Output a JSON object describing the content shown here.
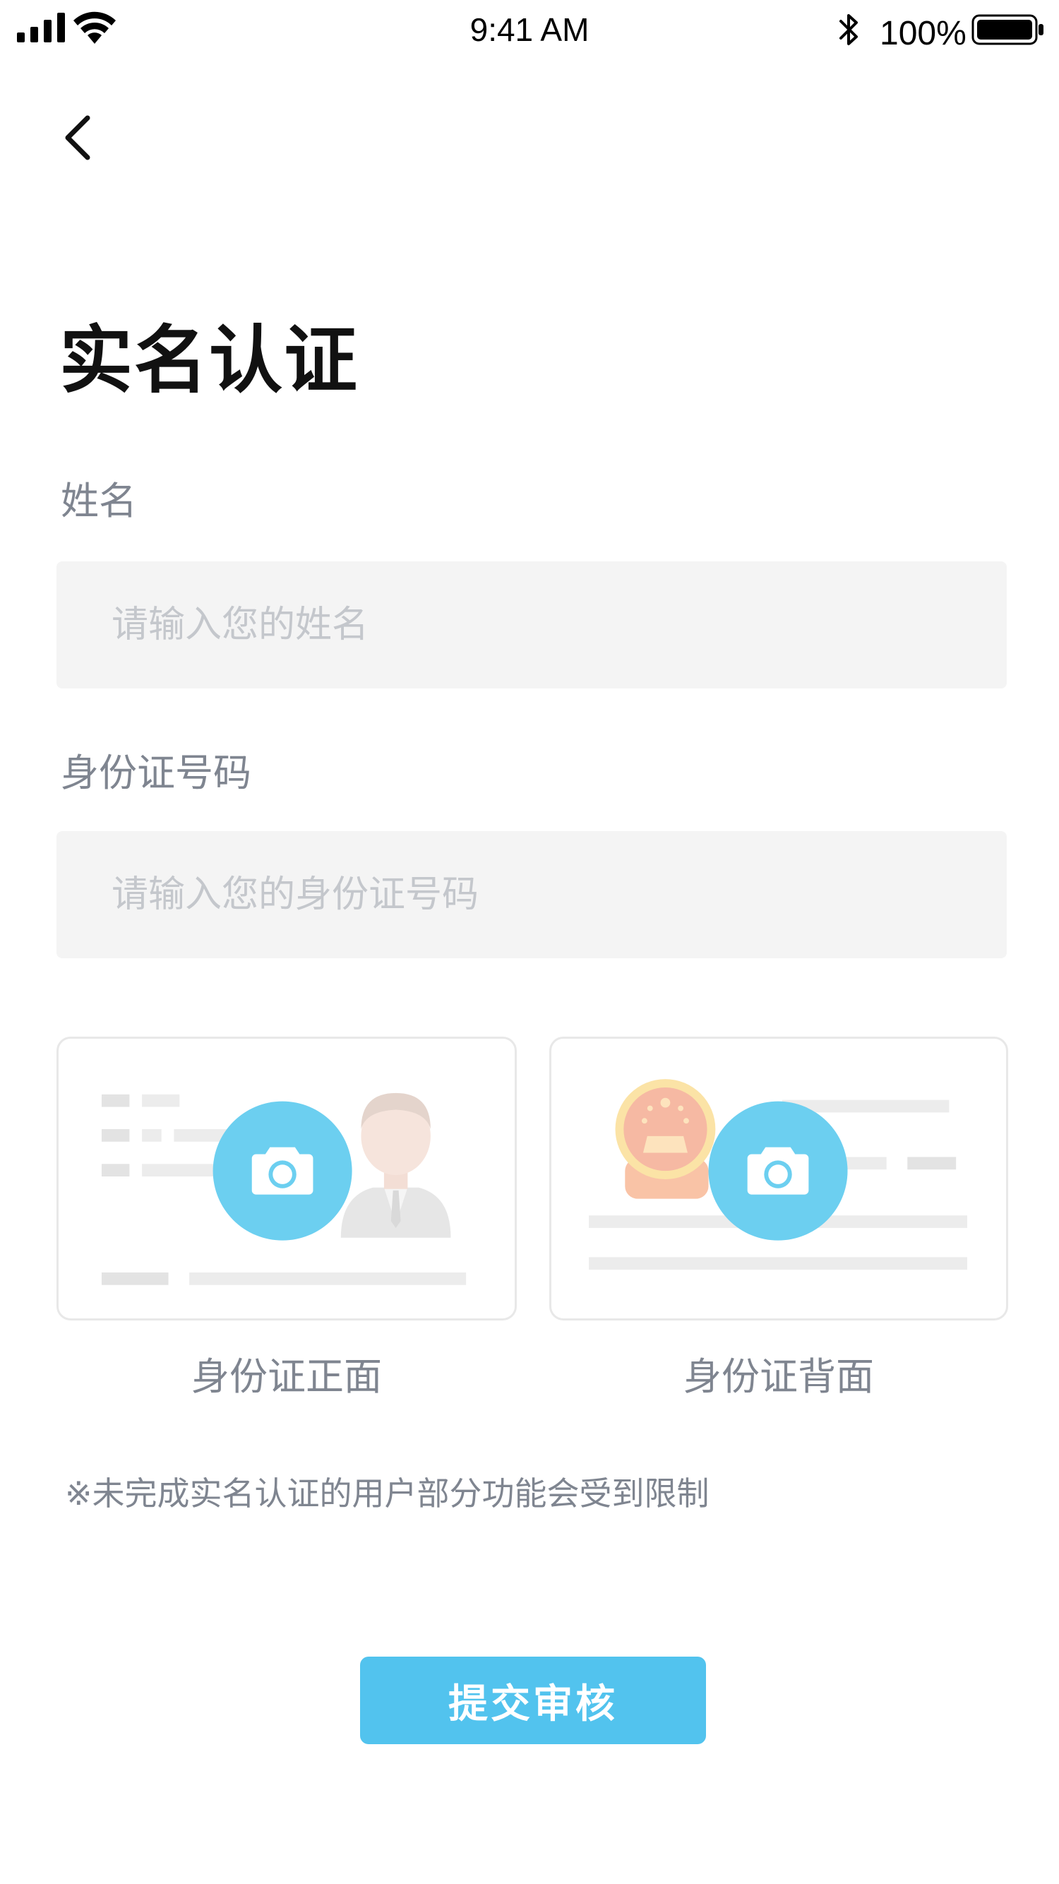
{
  "status_bar": {
    "time": "9:41 AM",
    "battery_percent": "100%",
    "icons": [
      "signal-icon",
      "wifi-icon",
      "bluetooth-icon",
      "battery-icon"
    ]
  },
  "nav": {
    "back_icon": "chevron-left-icon"
  },
  "page": {
    "title": "实名认证"
  },
  "form": {
    "name": {
      "label": "姓名",
      "placeholder": "请输入您的姓名",
      "value": ""
    },
    "id_number": {
      "label": "身份证号码",
      "placeholder": "请输入您的身份证号码",
      "value": ""
    }
  },
  "id_cards": {
    "front": {
      "caption": "身份证正面",
      "icon": "camera-icon"
    },
    "back": {
      "caption": "身份证背面",
      "icon": "camera-icon"
    }
  },
  "notice": "※未完成实名认证的用户部分功能会受到限制",
  "submit_label": "提交审核",
  "colors": {
    "accent": "#52c3ee",
    "camera_circle": "#6ccff0",
    "label_gray": "#7f8590",
    "input_bg": "#f4f4f4",
    "placeholder_gray": "#c4c7cc"
  }
}
